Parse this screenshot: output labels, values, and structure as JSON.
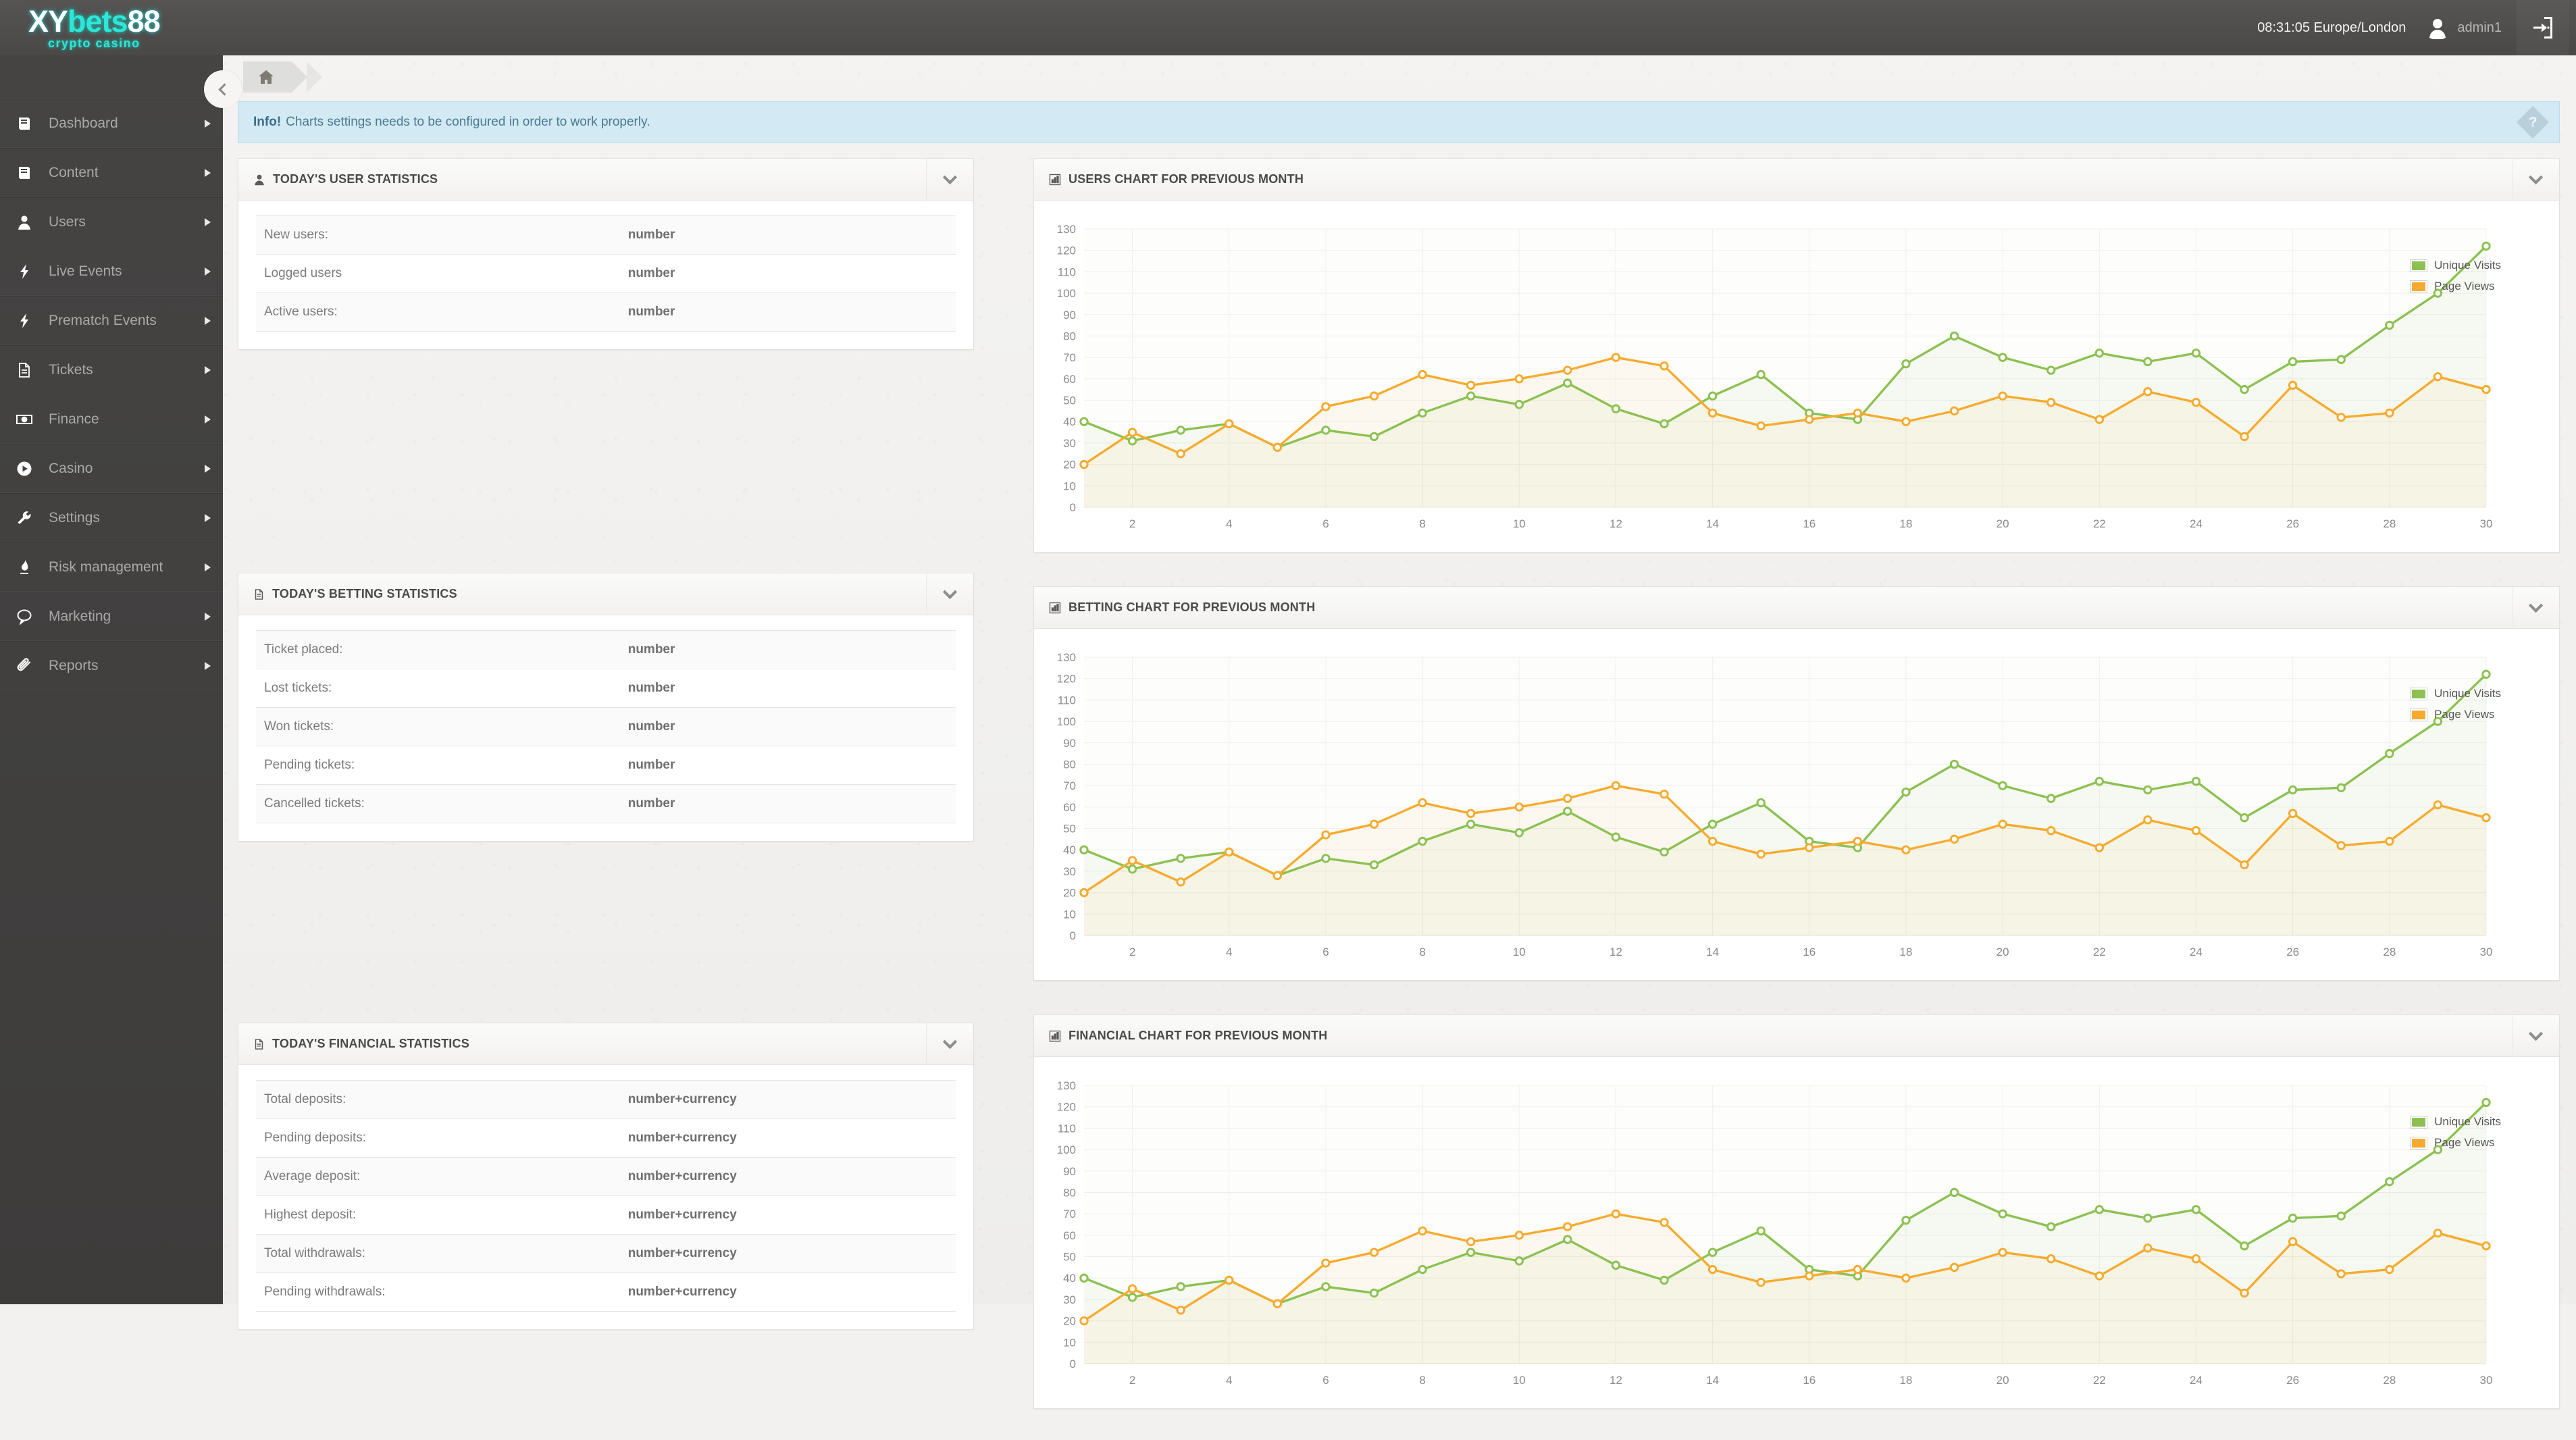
{
  "brand": {
    "logo_xy": "XY",
    "logo_bets": "bets",
    "logo_88": "88",
    "logo_sub": "crypto casino"
  },
  "header": {
    "clock": "08:31:05 Europe/London",
    "username": "admin1",
    "logout_icon": "logout-icon",
    "avatar_icon": "user-avatar-icon"
  },
  "sidebar": {
    "collapse_icon": "chevron-left-icon",
    "items": [
      {
        "label": "Dashboard",
        "icon": "book-icon"
      },
      {
        "label": "Content",
        "icon": "book-icon"
      },
      {
        "label": "Users",
        "icon": "user-icon"
      },
      {
        "label": "Live Events",
        "icon": "bolt-icon"
      },
      {
        "label": "Prematch Events",
        "icon": "bolt-icon"
      },
      {
        "label": "Tickets",
        "icon": "file-icon"
      },
      {
        "label": "Finance",
        "icon": "banknote-icon"
      },
      {
        "label": "Casino",
        "icon": "play-circle-icon"
      },
      {
        "label": "Settings",
        "icon": "wrench-icon"
      },
      {
        "label": "Risk management",
        "icon": "fire-icon"
      },
      {
        "label": "Marketing",
        "icon": "comment-icon"
      },
      {
        "label": "Reports",
        "icon": "paperclip-icon"
      }
    ]
  },
  "breadcrumb": {
    "home_icon": "home-icon"
  },
  "alert": {
    "strong": "Info!",
    "text": "Charts settings needs to be configured in order to work properly.",
    "help_icon": "question-diamond-icon",
    "help_glyph": "?",
    "bg_color": "#d3e9f3",
    "text_color": "#4a7b92"
  },
  "panels": {
    "user_stats": {
      "title": "TODAY's USER STATISTICS",
      "icon": "user-icon",
      "toggle_icon": "chevron-down-icon",
      "rows": [
        {
          "key": "New users:",
          "value": "number"
        },
        {
          "key": "Logged users",
          "value": "number"
        },
        {
          "key": "Active users:",
          "value": "number"
        }
      ]
    },
    "betting_stats": {
      "title": "TODAY's BETTING STATISTICS",
      "icon": "file-icon",
      "toggle_icon": "chevron-down-icon",
      "rows": [
        {
          "key": "Ticket placed:",
          "value": "number"
        },
        {
          "key": "Lost tickets:",
          "value": "number"
        },
        {
          "key": "Won tickets:",
          "value": "number"
        },
        {
          "key": "Pending tickets:",
          "value": "number"
        },
        {
          "key": "Cancelled tickets:",
          "value": "number"
        }
      ]
    },
    "financial_stats": {
      "title": "TODAY's FINANCIAL STATISTICS",
      "icon": "file-icon",
      "toggle_icon": "chevron-down-icon",
      "rows": [
        {
          "key": "Total deposits:",
          "value": "number+currency"
        },
        {
          "key": "Pending deposits:",
          "value": "number+currency"
        },
        {
          "key": "Average deposit:",
          "value": "number+currency"
        },
        {
          "key": "Highest deposit:",
          "value": "number+currency"
        },
        {
          "key": "Total withdrawals:",
          "value": "number+currency"
        },
        {
          "key": "Pending withdrawals:",
          "value": "number+currency"
        }
      ]
    },
    "users_chart": {
      "title": "USERS CHART FOR PREVIOUS MONTH",
      "icon": "bar-chart-icon",
      "toggle_icon": "chevron-down-icon"
    },
    "betting_chart": {
      "title": "BETTING CHART FOR PREVIOUS MONTH",
      "icon": "bar-chart-icon",
      "toggle_icon": "chevron-down-icon"
    },
    "financial_chart": {
      "title": "FINANCIAL CHART FOR PREVIOUS MONTH",
      "icon": "bar-chart-icon",
      "toggle_icon": "chevron-down-icon"
    }
  },
  "chart_data": {
    "type": "line",
    "title": "USERS CHART FOR PREVIOUS MONTH",
    "xlabel": "",
    "ylabel": "",
    "xlim": [
      1,
      30
    ],
    "ylim": [
      0,
      130
    ],
    "ytick_step": 10,
    "yticks": [
      0,
      10,
      20,
      30,
      40,
      50,
      60,
      70,
      80,
      90,
      100,
      110,
      120,
      130
    ],
    "xticks": [
      2,
      4,
      6,
      8,
      10,
      12,
      14,
      16,
      18,
      20,
      22,
      24,
      26,
      28,
      30
    ],
    "grid": true,
    "legend_position": "top-right",
    "colors": {
      "unique_visits": "#8cc152",
      "page_views": "#f6ab2f"
    },
    "x": [
      1,
      2,
      3,
      4,
      5,
      6,
      7,
      8,
      9,
      10,
      11,
      12,
      13,
      14,
      15,
      16,
      17,
      18,
      19,
      20,
      21,
      22,
      23,
      24,
      25,
      26,
      27,
      28,
      29,
      30
    ],
    "series": [
      {
        "name": "Unique Visits",
        "color": "#8cc152",
        "values": [
          40,
          31,
          36,
          39,
          28,
          36,
          33,
          44,
          52,
          48,
          58,
          46,
          39,
          52,
          62,
          44,
          41,
          67,
          80,
          70,
          64,
          72,
          68,
          72,
          55,
          68,
          69,
          85,
          100,
          122
        ]
      },
      {
        "name": "Page Views",
        "color": "#f6ab2f",
        "values": [
          20,
          35,
          25,
          39,
          28,
          47,
          52,
          62,
          57,
          60,
          64,
          70,
          66,
          44,
          38,
          41,
          44,
          40,
          45,
          52,
          49,
          41,
          54,
          49,
          33,
          57,
          42,
          44,
          61,
          55
        ]
      }
    ],
    "repeated_in_panels": [
      "USERS CHART FOR PREVIOUS MONTH",
      "BETTING CHART FOR PREVIOUS MONTH",
      "FINANCIAL CHART FOR PREVIOUS MONTH"
    ]
  }
}
